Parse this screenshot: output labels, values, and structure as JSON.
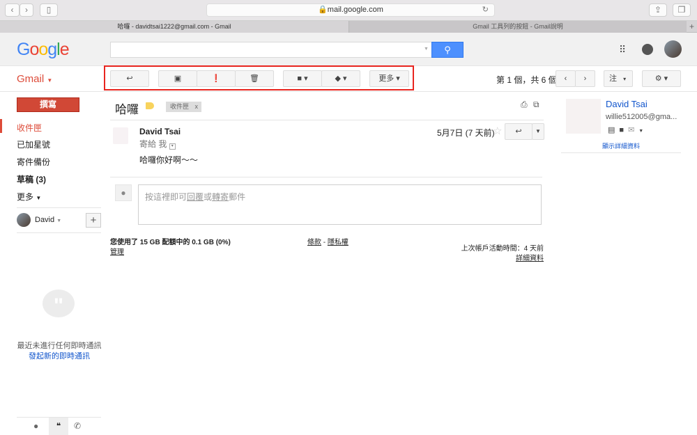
{
  "browser": {
    "url": "mail.google.com",
    "tabs": [
      "哈囉 - davidtsai1222@gmail.com - Gmail",
      "Gmail 工具列的按鈕 - Gmail說明"
    ],
    "new_tab": "+"
  },
  "header": {
    "logo": "Google",
    "search_placeholder": ""
  },
  "gmail_label": "Gmail",
  "toolbar": {
    "more": "更多",
    "pager": "第 1 個，共 6 個",
    "input_tools": "注"
  },
  "sidebar": {
    "compose": "撰寫",
    "items": [
      "收件匣",
      "已加星號",
      "寄件備份",
      "草稿 (3)",
      "更多"
    ],
    "user": "David",
    "hangouts_empty": "最近未進行任何即時通訊",
    "start_chat": "發起新的即時通訊"
  },
  "thread": {
    "subject": "哈囉",
    "label_chip": "收件匣",
    "label_remove": "x",
    "sender": "David Tsai",
    "to_prefix": "寄給",
    "to": "我",
    "date": "5月7日 (7 天前)",
    "body": "哈囉你好啊～～",
    "reply_prompt": {
      "before": "按這裡即可",
      "reply": "回覆",
      "or": "或",
      "forward": "轉寄",
      "after": "郵件"
    }
  },
  "footer": {
    "storage": "您使用了 15 GB 配額中的 0.1 GB (0%)",
    "manage": "管理",
    "terms": "條款",
    "sep": " - ",
    "privacy": "隱私權",
    "last_activity": "上次帳戶活動時間：4 天前",
    "details": "詳細資料"
  },
  "contact": {
    "name": "David Tsai",
    "email": "willie512005@gma...",
    "show_details": "顯示詳細資料"
  },
  "colors": {
    "accent": "#4d90fe",
    "compose": "#d14836",
    "highlight": "#e8251f"
  }
}
